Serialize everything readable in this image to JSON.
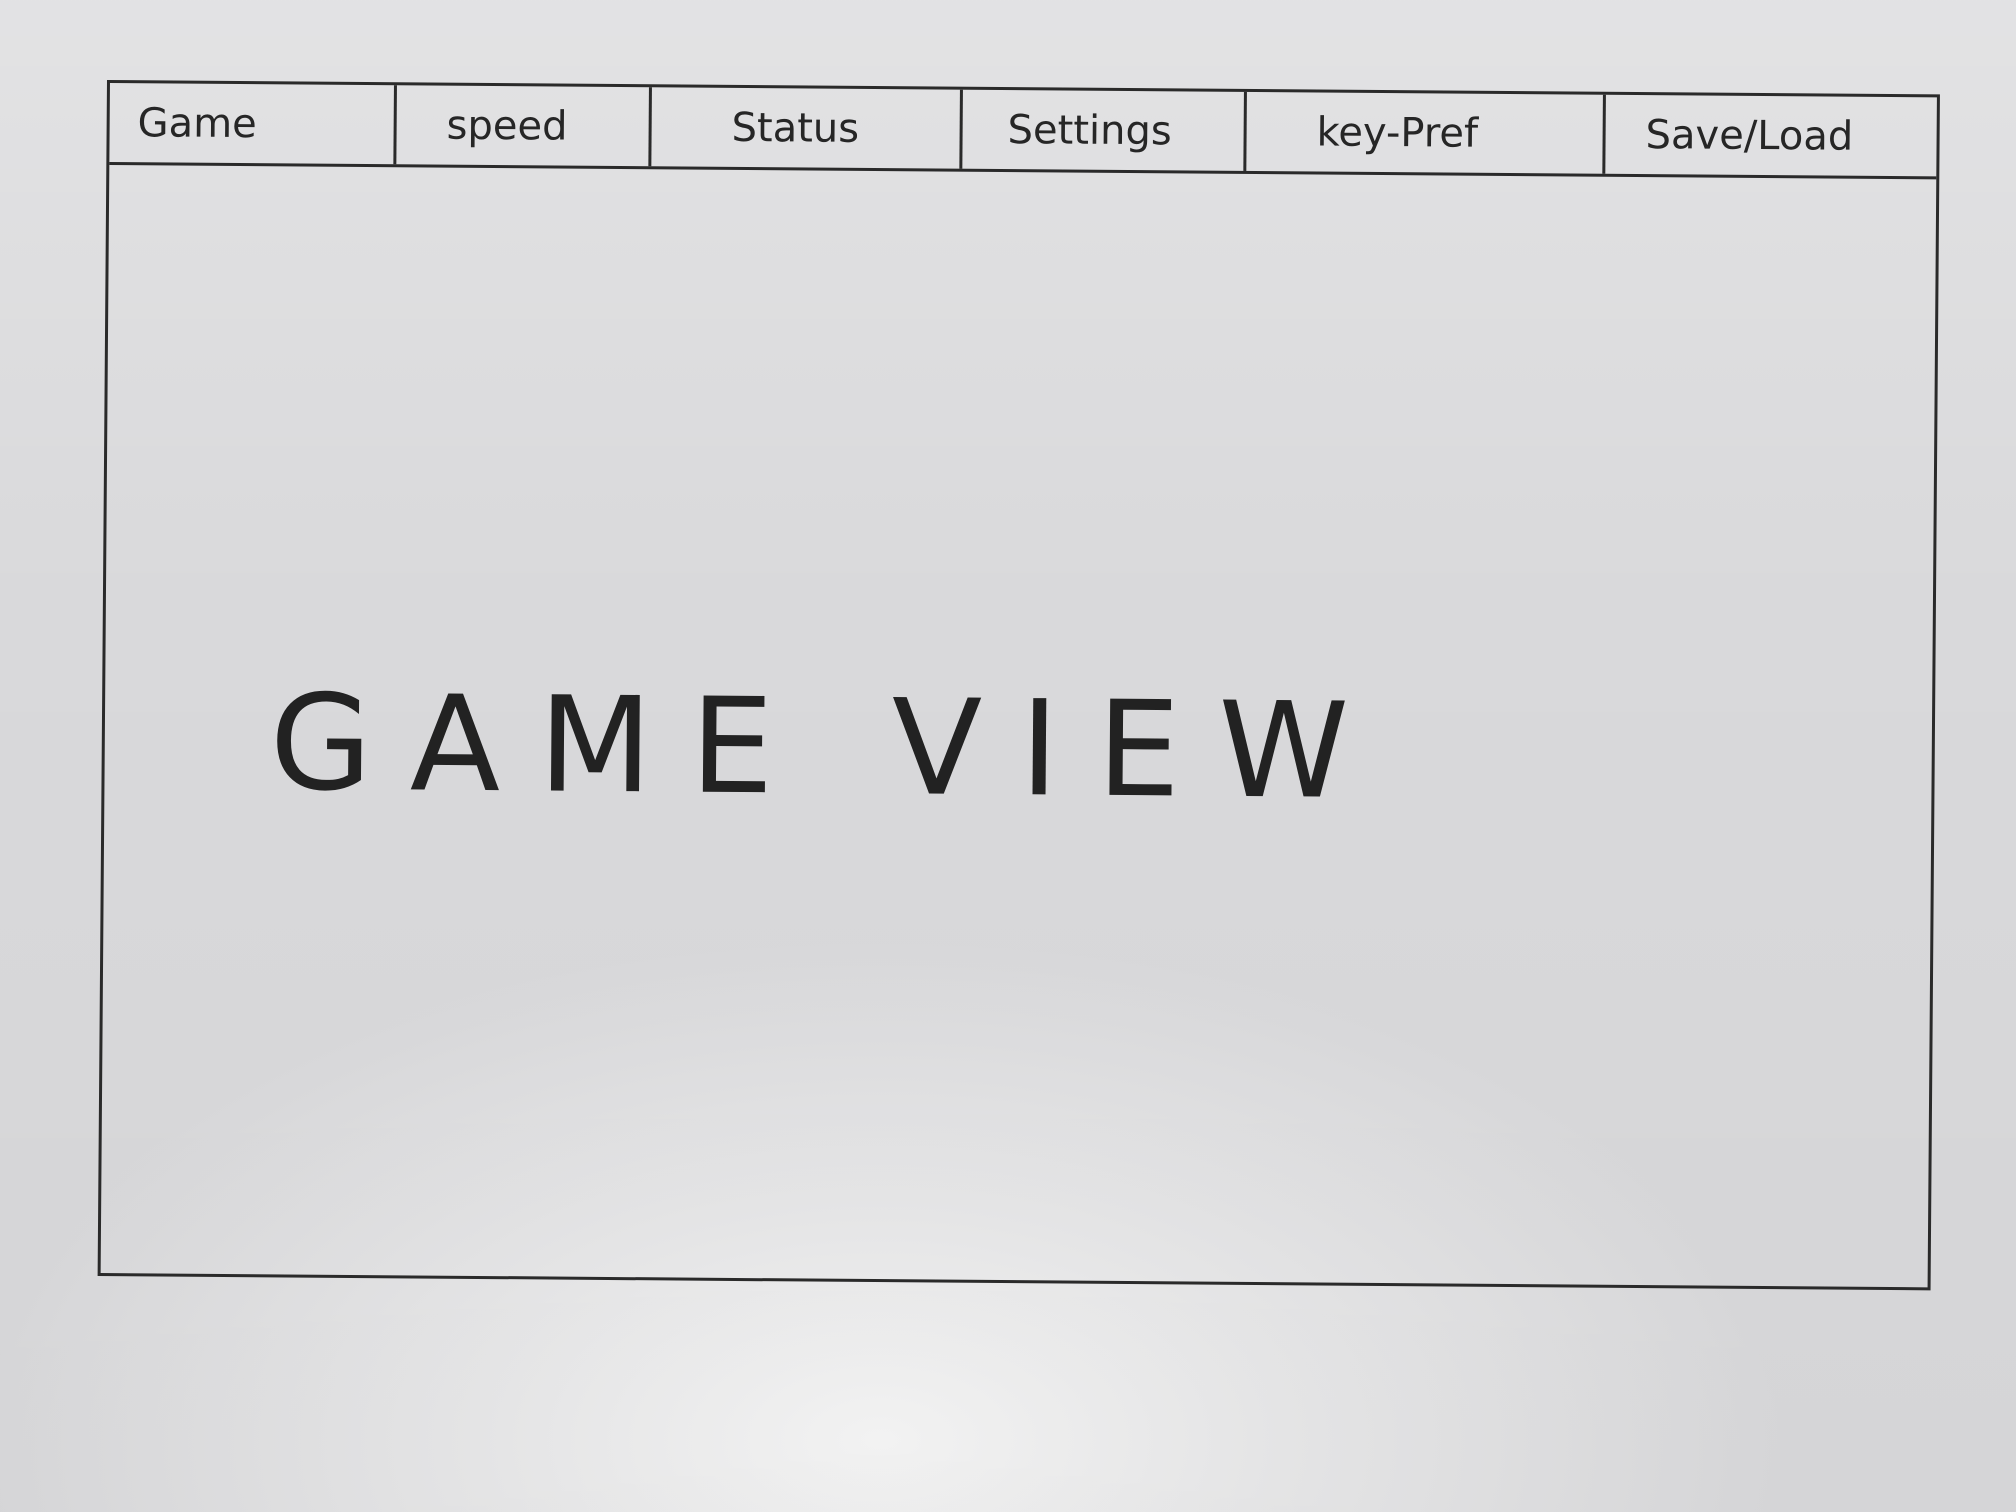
{
  "menubar": {
    "items": [
      {
        "label": "Game"
      },
      {
        "label": "speed"
      },
      {
        "label": "Status"
      },
      {
        "label": "Settings"
      },
      {
        "label": "key-Pref"
      },
      {
        "label": "Save/Load"
      }
    ]
  },
  "main": {
    "game_view_label": "GAME VIEW"
  },
  "colors": {
    "ink": "#2a2a2a",
    "paper": "#dcdcde"
  }
}
